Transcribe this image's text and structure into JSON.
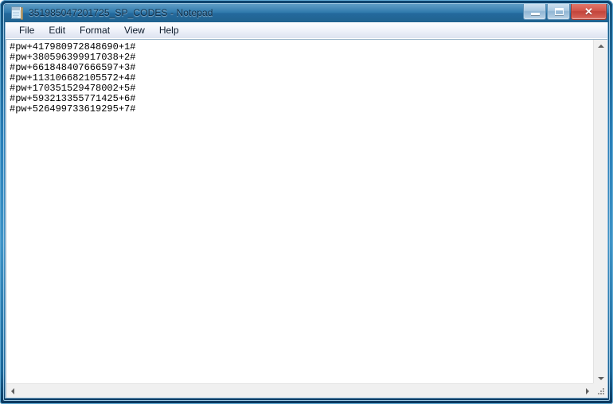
{
  "window": {
    "title": "351985047201725_SP_CODES - Notepad",
    "icon": "notepad-document-icon",
    "frame_accent": "#2a7fb8",
    "titlebar_color": "#2a75a9",
    "controls": {
      "minimize_label": "–",
      "maximize_label": "□",
      "close_label": "✕",
      "close_color": "#c2443b"
    }
  },
  "menu": {
    "items": [
      {
        "label": "File"
      },
      {
        "label": "Edit"
      },
      {
        "label": "Format"
      },
      {
        "label": "View"
      },
      {
        "label": "Help"
      }
    ]
  },
  "document": {
    "lines": [
      "#pw+417980972848690+1#",
      "#pw+380596399917038+2#",
      "#pw+661848407666597+3#",
      "#pw+113106682105572+4#",
      "#pw+170351529478002+5#",
      "#pw+593213355771425+6#",
      "#pw+526499733619295+7#"
    ],
    "background": "#ffffff",
    "text_color": "#000000"
  },
  "scrollbars": {
    "vertical": {
      "up_arrow": "scroll-up-arrow",
      "down_arrow": "scroll-down-arrow"
    },
    "horizontal": {
      "left_arrow": "scroll-left-arrow",
      "right_arrow": "scroll-right-arrow"
    },
    "resize_grip": "resize-grip"
  }
}
